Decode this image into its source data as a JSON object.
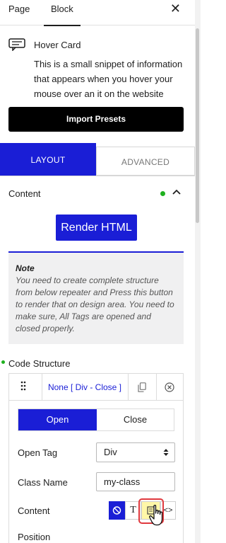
{
  "sidebar_tabs": {
    "page": "Page",
    "block": "Block",
    "close_icon": "close-icon"
  },
  "block_info": {
    "icon": "hover-card-icon",
    "title": "Hover Card",
    "description": "This is a small snippet of information that appears when you hover your mouse over an it on the website"
  },
  "import_presets": "Import Presets",
  "panel_tabs": {
    "layout": "LAYOUT",
    "advanced": "ADVANCED"
  },
  "content_section": {
    "title": "Content",
    "status_color": "#1fb11f"
  },
  "render_button": "Render HTML",
  "note": {
    "title": "Note",
    "text": "You need to create complete structure from below repeater and Press this button to render that on design area. You need to make sure, All Tags are opened and closed properly."
  },
  "code_structure": {
    "label": "Code Structure",
    "item": {
      "title": "None [ Div - Close ]",
      "open_label": "Open",
      "close_label": "Close",
      "open_tag_label": "Open Tag",
      "open_tag_value": "Div",
      "class_name_label": "Class Name",
      "class_name_value": "my-class",
      "content_label": "Content",
      "content_text_glyph": "T",
      "content_code_glyph": "<>",
      "position_label": "Position"
    }
  },
  "colors": {
    "accent": "#1a1ed6",
    "highlight": "#fff7a8",
    "focus_ring": "#e0393e"
  }
}
